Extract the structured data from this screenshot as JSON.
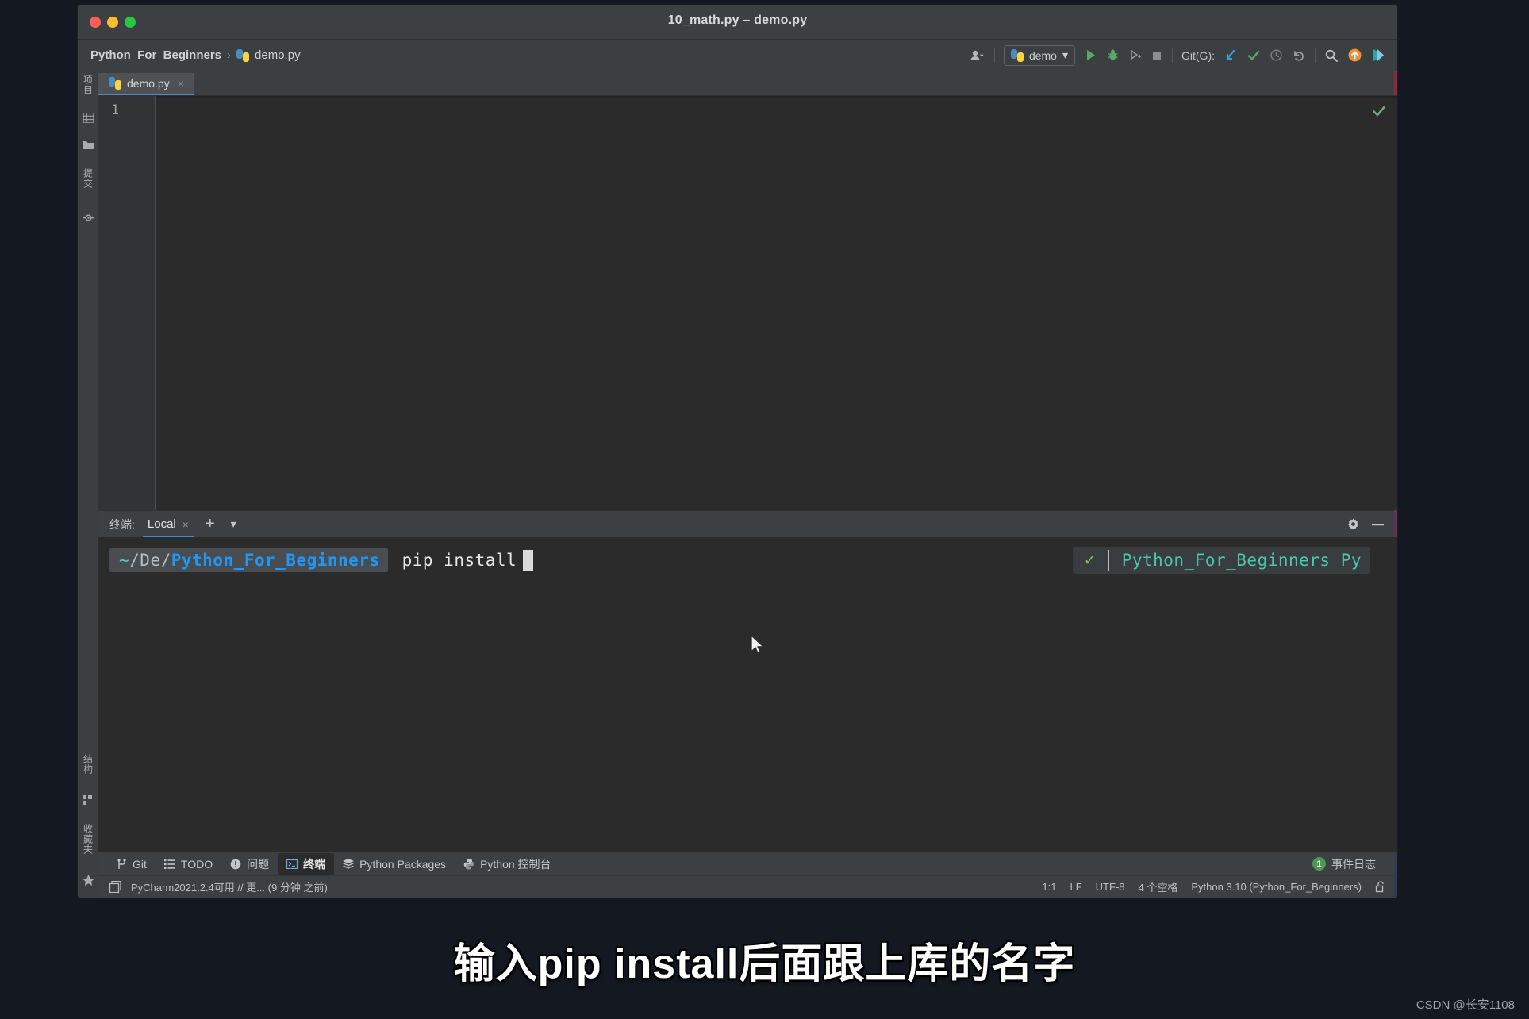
{
  "window": {
    "title": "10_math.py – demo.py",
    "traffic_lights": [
      "close-red",
      "minimize-yellow",
      "maximize-green"
    ]
  },
  "breadcrumb": {
    "project": "Python_For_Beginners",
    "separator": "›",
    "file": "demo.py",
    "file_icon": "python-file-icon"
  },
  "toolbar": {
    "user_icon": "user-avatar-icon",
    "run_config": {
      "label": "demo",
      "icon": "python-config-icon",
      "chevron": "▾"
    },
    "run_icon": "run-play-icon",
    "debug_icon": "debug-bug-icon",
    "coverage_icon": "run-coverage-icon",
    "stop_icon": "stop-square-icon",
    "git_label": "Git(G):",
    "git_update_icon": "git-update-arrow-icon",
    "git_commit_icon": "git-commit-check-icon",
    "git_history_icon": "git-history-clock-icon",
    "git_rollback_icon": "git-rollback-undo-icon",
    "search_icon": "search-magnifier-icon",
    "update_icon": "update-arrow-circle-icon",
    "ai_icon": "ide-assistant-icon"
  },
  "left_stripe": {
    "top_items": [
      {
        "label": "项目",
        "icon": "project-grid-icon"
      },
      {
        "label": "",
        "icon": "folder-icon"
      },
      {
        "label": "提交",
        "icon": "commit-icon"
      },
      {
        "label": "",
        "icon": "pull-requests-icon"
      }
    ],
    "bottom_items": [
      {
        "label": "结构",
        "icon": "structure-icon"
      },
      {
        "label": "收藏夹",
        "icon": "favorites-star-icon"
      }
    ]
  },
  "editor": {
    "tab": {
      "label": "demo.py",
      "icon": "python-file-icon",
      "close": "×"
    },
    "line_numbers": [
      "1"
    ],
    "content": "",
    "inspection_status_icon": "inspection-ok-check-icon"
  },
  "terminal": {
    "header_label": "终端:",
    "tab": {
      "label": "Local",
      "close": "×"
    },
    "add_icon": "add-plus-icon",
    "dropdown_icon": "chevron-down-icon",
    "settings_icon": "gear-settings-icon",
    "minimize_icon": "minimize-dash-icon",
    "prompt": {
      "tilde": "~",
      "mid_path": "/De/",
      "project": "Python_For_Beginners"
    },
    "command": "pip install",
    "cursor": "block-cursor",
    "right_status": {
      "check_icon": "status-ok-check-icon",
      "text": "Python_For_Beginners Py"
    }
  },
  "toolwindow_bar": {
    "items": [
      {
        "label": "Git",
        "icon": "git-branch-icon",
        "active": false
      },
      {
        "label": "TODO",
        "icon": "todo-list-icon",
        "active": false
      },
      {
        "label": "问题",
        "icon": "problems-warning-icon",
        "active": false
      },
      {
        "label": "终端",
        "icon": "terminal-icon",
        "active": true
      },
      {
        "label": "Python Packages",
        "icon": "packages-stack-icon",
        "active": false
      },
      {
        "label": "Python 控制台",
        "icon": "python-console-icon",
        "active": false
      }
    ],
    "event_log": {
      "label": "事件日志",
      "count": "1"
    }
  },
  "statusbar": {
    "notification_icon": "notification-window-icon",
    "message": "PyCharm2021.2.4可用 // 更... (9 分钟 之前)",
    "caret": "1:1",
    "line_separator": "LF",
    "encoding": "UTF-8",
    "indent": "4 个空格",
    "interpreter": "Python 3.10 (Python_For_Beginners)",
    "lock_icon": "lock-open-icon"
  },
  "caption": "输入pip install后面跟上库的名字",
  "watermark": "CSDN @长安1108",
  "colors": {
    "accent_blue": "#4a88c7",
    "prompt_blue": "#2196f3",
    "prompt_cyan": "#56c8d8",
    "status_teal": "#4cc5b0",
    "ok_green": "#7ec450",
    "ide_bg": "#3c3f41",
    "editor_bg": "#2b2b2b"
  }
}
